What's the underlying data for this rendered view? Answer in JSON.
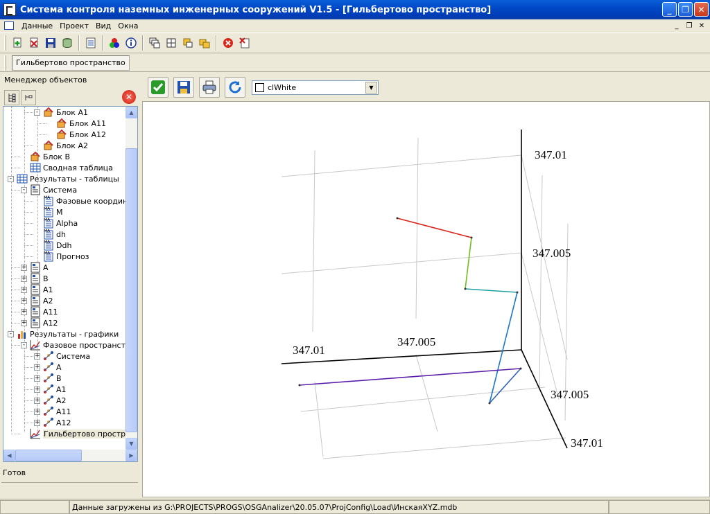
{
  "window": {
    "title": "Система контроля наземных инженерных сооружений V1.5 - [Гильбертово пространство]",
    "buttons": {
      "minimize": "_",
      "maximize": "❐",
      "close": "✕"
    }
  },
  "menu": {
    "items": [
      {
        "label": "Данные"
      },
      {
        "label": "Проект"
      },
      {
        "label": "Вид"
      },
      {
        "label": "Окна"
      }
    ]
  },
  "toolbar": {
    "icons": [
      "add-icon",
      "delete-icon",
      "save-icon",
      "database-icon",
      "checklist-icon",
      "colors-icon",
      "info-icon",
      "cascade-icon",
      "tile-icon",
      "arrange-icon",
      "minimize-all-icon",
      "stop-icon",
      "close-window-icon"
    ]
  },
  "window_tab": {
    "label": "Гильбертово пространство"
  },
  "left_panel": {
    "title": "Менеджер объектов",
    "status": "Готов",
    "tree": [
      {
        "label": "Блок A1",
        "indent": 2,
        "expander": "-",
        "icon": "block"
      },
      {
        "label": "Блок A11",
        "indent": 3,
        "expander": "",
        "icon": "block"
      },
      {
        "label": "Блок A12",
        "indent": 3,
        "expander": "",
        "icon": "block"
      },
      {
        "label": "Блок A2",
        "indent": 2,
        "expander": "",
        "icon": "block"
      },
      {
        "label": "Блок B",
        "indent": 1,
        "expander": "",
        "icon": "block"
      },
      {
        "label": "Сводная таблица",
        "indent": 1,
        "expander": "",
        "icon": "table"
      },
      {
        "label": "Результаты - таблицы",
        "indent": 0,
        "expander": "-",
        "icon": "table"
      },
      {
        "label": "Система",
        "indent": 1,
        "expander": "-",
        "icon": "grid"
      },
      {
        "label": "Фазовые координаты",
        "indent": 2,
        "expander": "",
        "icon": "calc"
      },
      {
        "label": "M",
        "indent": 2,
        "expander": "",
        "icon": "calc"
      },
      {
        "label": "Alpha",
        "indent": 2,
        "expander": "",
        "icon": "calc"
      },
      {
        "label": "dh",
        "indent": 2,
        "expander": "",
        "icon": "calc"
      },
      {
        "label": "Ddh",
        "indent": 2,
        "expander": "",
        "icon": "calc"
      },
      {
        "label": "Прогноз",
        "indent": 2,
        "expander": "",
        "icon": "calc"
      },
      {
        "label": "A",
        "indent": 1,
        "expander": "+",
        "icon": "grid"
      },
      {
        "label": "B",
        "indent": 1,
        "expander": "+",
        "icon": "grid"
      },
      {
        "label": "A1",
        "indent": 1,
        "expander": "+",
        "icon": "grid"
      },
      {
        "label": "A2",
        "indent": 1,
        "expander": "+",
        "icon": "grid"
      },
      {
        "label": "A11",
        "indent": 1,
        "expander": "+",
        "icon": "grid"
      },
      {
        "label": "A12",
        "indent": 1,
        "expander": "+",
        "icon": "grid"
      },
      {
        "label": "Результаты - графики",
        "indent": 0,
        "expander": "-",
        "icon": "chart"
      },
      {
        "label": "Фазовое пространство",
        "indent": 1,
        "expander": "-",
        "icon": "graph"
      },
      {
        "label": "Система",
        "indent": 2,
        "expander": "+",
        "icon": "scatter"
      },
      {
        "label": "A",
        "indent": 2,
        "expander": "+",
        "icon": "scatter"
      },
      {
        "label": "B",
        "indent": 2,
        "expander": "+",
        "icon": "scatter"
      },
      {
        "label": "A1",
        "indent": 2,
        "expander": "+",
        "icon": "scatter"
      },
      {
        "label": "A2",
        "indent": 2,
        "expander": "+",
        "icon": "scatter"
      },
      {
        "label": "A11",
        "indent": 2,
        "expander": "+",
        "icon": "scatter"
      },
      {
        "label": "A12",
        "indent": 2,
        "expander": "+",
        "icon": "scatter"
      },
      {
        "label": "Гильбертово пространство",
        "indent": 1,
        "expander": "",
        "icon": "graph",
        "selected": true
      }
    ]
  },
  "plot_toolbar": {
    "icons": [
      "apply-check-icon",
      "save-icon",
      "print-icon",
      "refresh-icon"
    ],
    "color_combo": {
      "value": "clWhite"
    }
  },
  "chart_data": {
    "type": "line",
    "title": "",
    "tick_labels": [
      "347.01",
      "347.005",
      "347.01",
      "347.005",
      "347.005",
      "347.01"
    ],
    "series_colors": [
      "#d9241c",
      "#6fbf1f",
      "#1f78c8",
      "#2f5fb8",
      "#5a1fa8"
    ],
    "note": "3D trajectory in Hilbert space; values near 347.005-347.01 on each axis"
  },
  "statusbar": {
    "pane1": "",
    "pane2": "Данные загружены из G:\\PROJECTS\\PROGS\\OSGAnalizer\\20.05.07\\ProjConfig\\Load\\ИнскаяXYZ.mdb",
    "pane3": ""
  }
}
